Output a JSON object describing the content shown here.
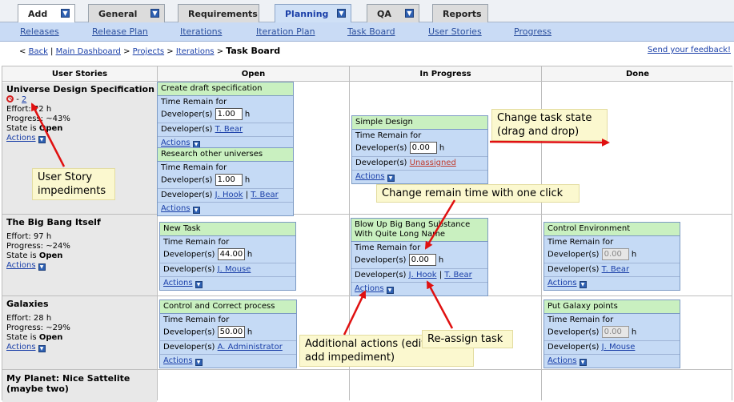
{
  "tabs": [
    {
      "label": "Add",
      "active": false
    },
    {
      "label": "General",
      "active": false
    },
    {
      "label": "Requirements",
      "active": false
    },
    {
      "label": "Planning",
      "active": true
    },
    {
      "label": "QA",
      "active": false
    },
    {
      "label": "Reports",
      "active": false
    }
  ],
  "subnav": [
    "Releases",
    "Release Plan",
    "Iterations",
    "Iteration Plan",
    "Task Board",
    "User Stories",
    "Progress"
  ],
  "breadcrumb": {
    "prefix": "<",
    "back": "Back",
    "main": "Main Dashboard",
    "projects": "Projects",
    "iterations": "Iterations",
    "sep": ">",
    "current": "Task Board",
    "feedback": "Send your feedback!"
  },
  "columns": {
    "stories": "User Stories",
    "open": "Open",
    "inprogress": "In Progress",
    "done": "Done"
  },
  "labels": {
    "time_remain_for": "Time Remain for",
    "developers": "Developer(s)",
    "h": "h",
    "actions": "Actions",
    "effort": "Effort:",
    "progress": "Progress:",
    "state_is": "State is",
    "pipe": "|"
  },
  "stories": [
    {
      "title": "Universe Design Specification",
      "impediment_sep": "-",
      "impediments": "2",
      "effort": "72 h",
      "progress": "~43%",
      "state": "Open"
    },
    {
      "title": "The Big Bang Itself",
      "effort": "97 h",
      "progress": "~24%",
      "state": "Open"
    },
    {
      "title": "Galaxies",
      "effort": "28 h",
      "progress": "~29%",
      "state": "Open"
    },
    {
      "title": "My Planet: Nice Sattelite (maybe two)"
    }
  ],
  "cards": {
    "draft": {
      "title": "Create draft specification",
      "remain": "1.00",
      "dev": "T. Bear"
    },
    "research": {
      "title": "Research other universes",
      "remain": "1.00",
      "dev1": "J. Hook",
      "dev2": "T. Bear"
    },
    "simple": {
      "title": "Simple Design",
      "remain": "0.00",
      "dev": "Unassigned"
    },
    "newtask": {
      "title": "New Task",
      "remain": "44.00",
      "dev": "J. Mouse"
    },
    "blowup": {
      "title": "Blow Up Big Bang Substance With Quite Long Name",
      "remain": "0.00",
      "dev1": "J. Hook",
      "dev2": "T. Bear"
    },
    "control": {
      "title": "Control Environment",
      "remain": "0.00",
      "dev": "T. Bear"
    },
    "correct": {
      "title": "Control and Correct process",
      "remain": "50.00",
      "dev": "A. Administrator"
    },
    "galaxy": {
      "title": "Put Galaxy points",
      "remain": "0.00",
      "dev": "J. Mouse"
    }
  },
  "callouts": {
    "impediments": "User Story impediments",
    "state": "Change task state (drag and drop)",
    "remain": "Change remain time with one click",
    "actions": "Additional actions (edit, view, add impediment)",
    "reassign": "Re-assign task"
  },
  "colors": {
    "arrow": "#e01010",
    "card": "#c5daf5",
    "card_header": "#c9f0c0",
    "callout": "#fbf8cf"
  }
}
